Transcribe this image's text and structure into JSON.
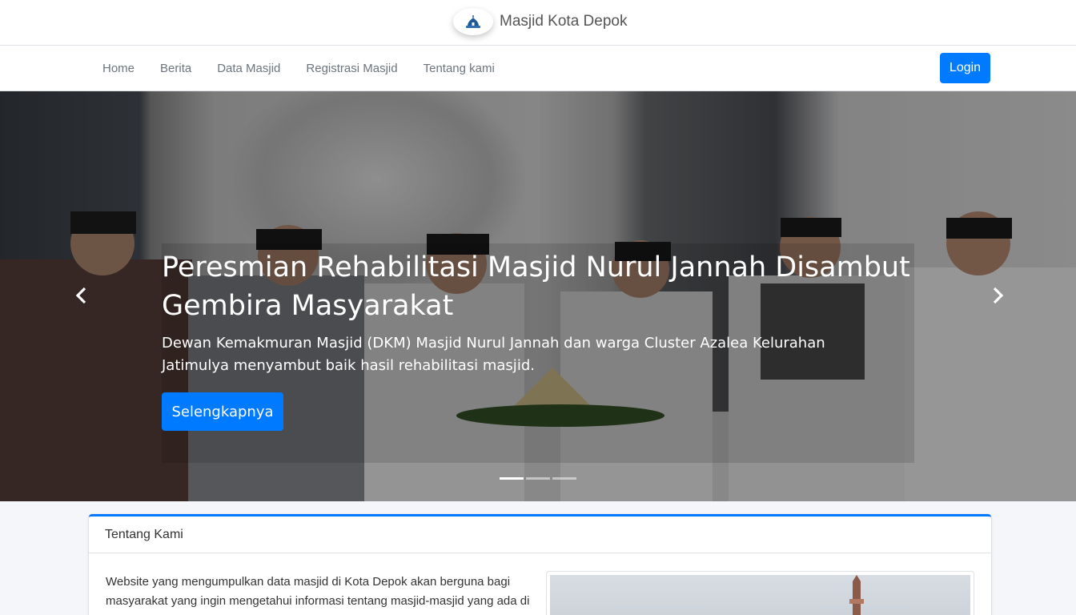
{
  "brand": {
    "title": "Masjid Kota Depok"
  },
  "nav": {
    "items": [
      "Home",
      "Berita",
      "Data Masjid",
      "Registrasi Masjid",
      "Tentang kami"
    ],
    "login_label": "Login"
  },
  "hero": {
    "title": "Peresmian Rehabilitasi Masjid Nurul Jannah Disambut Gembira Masyarakat",
    "description": "Dewan Kemakmuran Masjid (DKM) Masjid Nurul Jannah dan warga Cluster Azalea Kelurahan Jatimulya menyambut baik hasil rehabilitasi masjid.",
    "button_label": "Selengkapnya",
    "slides_count": 3,
    "active_slide": 1
  },
  "about": {
    "header": "Tentang Kami",
    "text": "Website yang mengumpulkan data masjid di Kota Depok akan berguna bagi masyarakat yang ingin mengetahui informasi tentang masjid-masjid yang ada di kota tersebut. Website ini dapat menyediakan informasi seperti nama masjid,"
  },
  "icons": {
    "prev": "chevron-left-icon",
    "next": "chevron-right-icon",
    "logo": "mosque-icon"
  },
  "colors": {
    "primary": "#007bff"
  }
}
